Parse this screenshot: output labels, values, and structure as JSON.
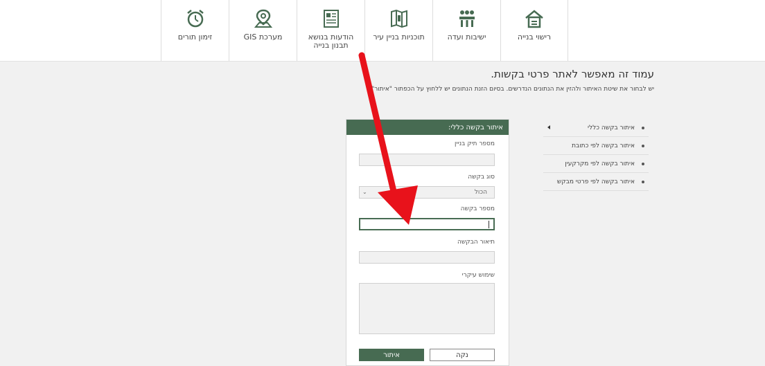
{
  "nav": {
    "items": [
      {
        "label": "רישוי בנייה",
        "icon": "house-icon"
      },
      {
        "label": "ישיבות ועדה",
        "icon": "meeting-icon"
      },
      {
        "label": "תוכניות בניין עיר",
        "icon": "map-book-icon"
      },
      {
        "label": "הודעות בנושא\nתבנון בנייה",
        "icon": "document-icon"
      },
      {
        "label": "מערכת GIS",
        "icon": "map-pin-icon"
      },
      {
        "label": "זימון תורים",
        "icon": "alarm-clock-icon"
      }
    ]
  },
  "page": {
    "title": "עמוד זה מאפשר לאתר פרטי בקשות.",
    "subtitle": "יש לבחור את שיטת האיתור ולהזין את הנתונים הנדרשים. בסיום הזנת הנתונים יש ללחוץ על הכפתור \"איתור\""
  },
  "side_menu": {
    "items": [
      {
        "label": "איתור בקשה כללי",
        "selected": true
      },
      {
        "label": "איתור בקשה לפי כתובת",
        "selected": false
      },
      {
        "label": "איתור בקשה לפי מקרקעין",
        "selected": false
      },
      {
        "label": "איתור בקשה לפי פרטי מבקש",
        "selected": false
      }
    ]
  },
  "form": {
    "header": "איתור בקשה כללי:",
    "file_label": "מספר תיק בניין",
    "file_value": "",
    "type_label": "סוג בקשה",
    "type_value": "הכול",
    "request_no_label": "מספר בקשה",
    "request_no_value": "",
    "description_label": "תיאור הבקשה",
    "description_value": "",
    "usage_label": "שימוש עיקרי",
    "usage_value": "",
    "search_button": "איתור",
    "clear_button": "נקה"
  },
  "colors": {
    "accent": "#476b52",
    "annotation_arrow": "#e8121b"
  }
}
